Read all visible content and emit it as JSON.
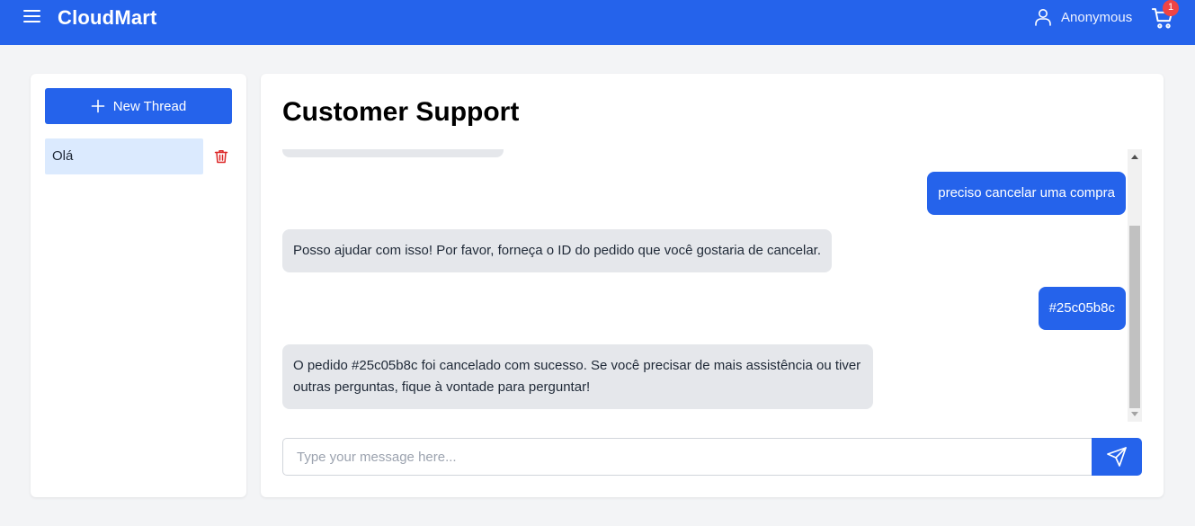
{
  "app": {
    "brand": "CloudMart"
  },
  "header": {
    "user_name": "Anonymous",
    "cart_count": "1"
  },
  "sidebar": {
    "new_thread_label": "New Thread",
    "threads": [
      {
        "label": "Olá"
      }
    ]
  },
  "main": {
    "title": "Customer Support",
    "messages": [
      {
        "role": "user",
        "text": "preciso cancelar uma compra"
      },
      {
        "role": "assistant",
        "text": "Posso ajudar com isso! Por favor, forneça o ID do pedido que você gostaria de cancelar."
      },
      {
        "role": "user",
        "text": "#25c05b8c"
      },
      {
        "role": "assistant",
        "text": "O pedido #25c05b8c foi cancelado com sucesso. Se você precisar de mais assistência ou tiver outras perguntas, fique à vontade para perguntar!"
      }
    ],
    "input": {
      "placeholder": "Type your message here...",
      "value": ""
    }
  },
  "colors": {
    "primary": "#2563eb",
    "thread_active_bg": "#dbeafe",
    "assistant_bubble": "#e5e7eb",
    "danger": "#ef4444"
  }
}
